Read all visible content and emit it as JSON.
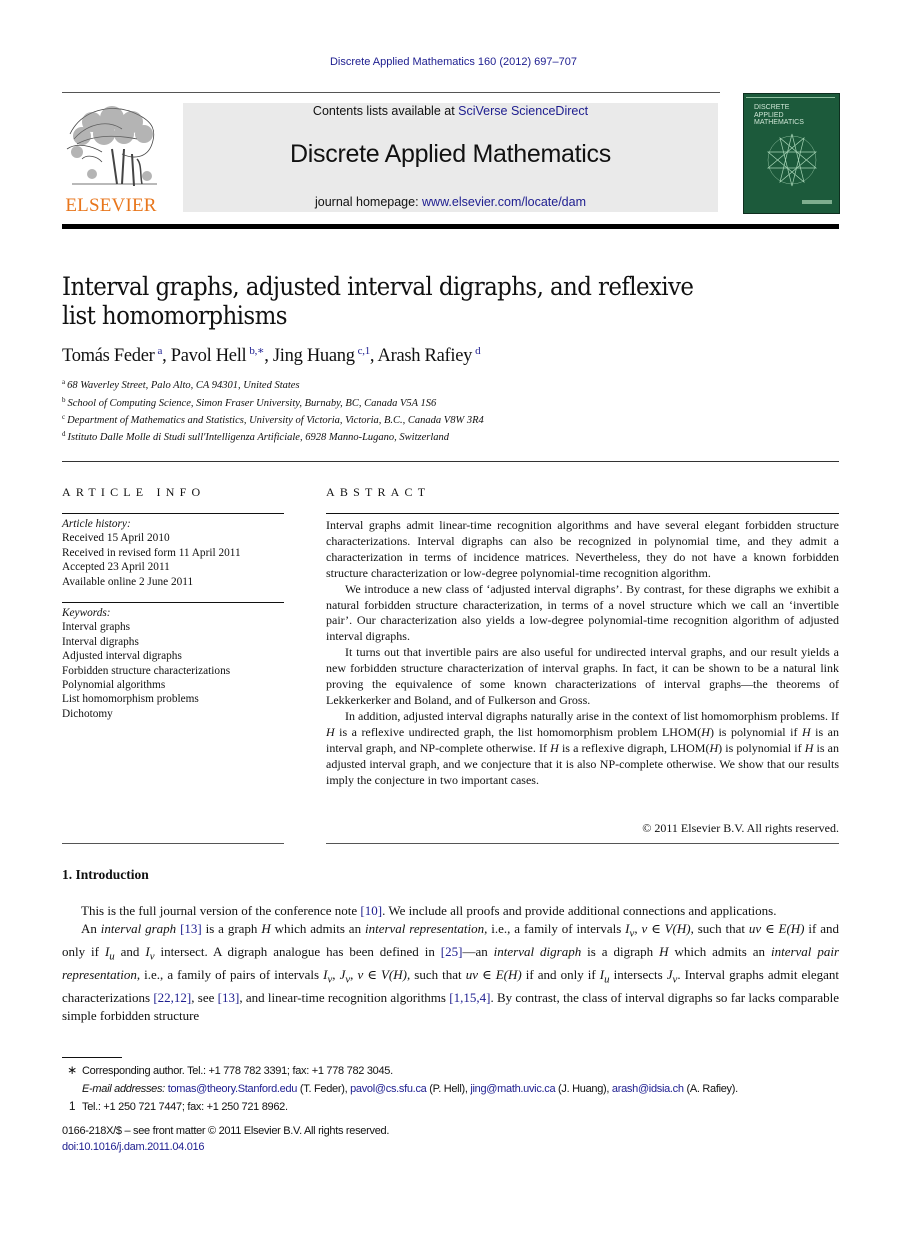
{
  "header": {
    "citation": "Discrete Applied Mathematics 160 (2012) 697–707",
    "contents_prefix": "Contents lists available at ",
    "contents_link": "SciVerse ScienceDirect",
    "journal_name": "Discrete Applied Mathematics",
    "homepage_prefix": "journal homepage: ",
    "homepage_link": "www.elsevier.com/locate/dam",
    "publisher_logo_text": "ELSEVIER",
    "cover_title_lines": [
      "DISCRETE",
      "APPLIED",
      "MATHEMATICS"
    ]
  },
  "colors": {
    "link": "#1d1d8f",
    "elsevier_orange": "#e8761c",
    "cover_green": "#1c5a3b",
    "masthead_gray": "#eaeaea"
  },
  "article": {
    "title_line1": "Interval graphs, adjusted interval digraphs, and reflexive",
    "title_line2": "list homomorphisms",
    "authors": [
      {
        "name": "Tomás Feder",
        "sup": "a"
      },
      {
        "name": "Pavol Hell",
        "sup": "b,∗"
      },
      {
        "name": "Jing Huang",
        "sup": "c,1"
      },
      {
        "name": "Arash Rafiey",
        "sup": "d"
      }
    ],
    "affiliations": [
      {
        "mark": "a",
        "text": "68 Waverley Street, Palo Alto, CA 94301, United States"
      },
      {
        "mark": "b",
        "text": "School of Computing Science, Simon Fraser University, Burnaby, BC, Canada V5A 1S6"
      },
      {
        "mark": "c",
        "text": "Department of Mathematics and Statistics, University of Victoria, Victoria, B.C., Canada V8W 3R4"
      },
      {
        "mark": "d",
        "text": "Istituto Dalle Molle di Studi sull'Intelligenza Artificiale, 6928 Manno-Lugano, Switzerland"
      }
    ]
  },
  "article_info": {
    "heading": "ARTICLE INFO",
    "history_label": "Article history:",
    "history": [
      "Received 15 April 2010",
      "Received in revised form 11 April 2011",
      "Accepted 23 April 2011",
      "Available online 2 June 2011"
    ],
    "keywords_label": "Keywords:",
    "keywords": [
      "Interval graphs",
      "Interval digraphs",
      "Adjusted interval digraphs",
      "Forbidden structure characterizations",
      "Polynomial algorithms",
      "List homomorphism problems",
      "Dichotomy"
    ]
  },
  "abstract": {
    "heading": "ABSTRACT",
    "p1": "Interval graphs admit linear-time recognition algorithms and have several elegant forbidden structure characterizations. Interval digraphs can also be recognized in polynomial time, and they admit a characterization in terms of incidence matrices. Nevertheless, they do not have a known forbidden structure characterization or low-degree polynomial-time recognition algorithm.",
    "p2": "We introduce a new class of ‘adjusted interval digraphs’. By contrast, for these digraphs we exhibit a natural forbidden structure characterization, in terms of a novel structure which we call an ‘invertible pair’. Our characterization also yields a low-degree polynomial-time recognition algorithm of adjusted interval digraphs.",
    "p3": "It turns out that invertible pairs are also useful for undirected interval graphs, and our result yields a new forbidden structure characterization of interval graphs. In fact, it can be shown to be a natural link proving the equivalence of some known characterizations of interval graphs—the theorems of Lekkerkerker and Boland, and of Fulkerson and Gross.",
    "p4": {
      "a": "In addition, adjusted interval digraphs naturally arise in the context of list homomorphism problems. If ",
      "H1": "H",
      "b": " is a reflexive undirected graph, the list homomorphism problem LHOM(",
      "H2": "H",
      "c": ") is polynomial if ",
      "H3": "H",
      "d": " is an interval graph, and NP-complete otherwise. If ",
      "H4": "H",
      "e": " is a reflexive digraph, LHOM(",
      "H5": "H",
      "f": ") is polynomial if ",
      "H6": "H",
      "g": " is an adjusted interval graph, and we conjecture that it is also NP-complete otherwise. We show that our results imply the conjecture in two important cases."
    },
    "copyright": "© 2011 Elsevier B.V. All rights reserved."
  },
  "introduction": {
    "heading": "1.  Introduction",
    "p1_a": "This is the full journal version of the conference note ",
    "p1_ref": "[10]",
    "p1_b": ". We include all proofs and provide additional connections and applications.",
    "p2": {
      "t1": "An ",
      "i1": "interval graph",
      "t2": " ",
      "r1": "[13]",
      "t3": " is a graph ",
      "m1": "H",
      "t4": " which admits an ",
      "i2": "interval representation",
      "t5": ", i.e., a family of intervals ",
      "m2": "I",
      "s2": "v",
      "t6": ", ",
      "m3": "v ∈ V(H)",
      "t7": ", such that ",
      "m4": "uv ∈ E(H)",
      "t8": " if and only if ",
      "m5": "I",
      "s5": "u",
      "t9": " and ",
      "m6": "I",
      "s6": "v",
      "t10": " intersect. A digraph analogue has been defined in ",
      "r2": "[25]",
      "t11": "—an ",
      "i3": "interval digraph",
      "t12": " is a digraph ",
      "m7": "H",
      "t13": " which admits an ",
      "i4": "interval pair representation",
      "t14": ", i.e., a family of pairs of intervals ",
      "m8": "I",
      "s8": "v",
      "t15": ", ",
      "m9": "J",
      "s9": "v",
      "t16": ", ",
      "m10": "v ∈ V(H)",
      "t17": ", such that ",
      "m11": "uv ∈ E(H)",
      "t18": " if and only if ",
      "m12": "I",
      "s12": "u",
      "t19": " intersects ",
      "m13": "J",
      "s13": "v",
      "t20": ". Interval graphs admit elegant characterizations ",
      "r3": "[22,12]",
      "t21": ",  see ",
      "r4": "[13]",
      "t22": ", and linear-time recognition algorithms ",
      "r5": "[1,15,4]",
      "t23": ". By contrast, the class of interval digraphs so far lacks comparable simple forbidden structure"
    }
  },
  "footnotes": {
    "star_mark": "∗",
    "star_text": "Corresponding author. Tel.: +1 778 782 3391; fax: +1 778 782 3045.",
    "email_label": "E-mail addresses:",
    "emails": [
      {
        "address": "tomas@theory.Stanford.edu",
        "who": " (T. Feder), "
      },
      {
        "address": "pavol@cs.sfu.ca",
        "who": " (P. Hell), "
      },
      {
        "address": "jing@math.uvic.ca",
        "who": " (J. Huang), "
      },
      {
        "address": "arash@idsia.ch",
        "who": " (A. Rafiey)."
      }
    ],
    "one_mark": "1",
    "one_text": "Tel.: +1 250 721 7447; fax: +1 250 721 8962."
  },
  "front_matter": {
    "issn_line": "0166-218X/$ – see front matter © 2011 Elsevier B.V. All rights reserved.",
    "doi": "doi:10.1016/j.dam.2011.04.016"
  }
}
